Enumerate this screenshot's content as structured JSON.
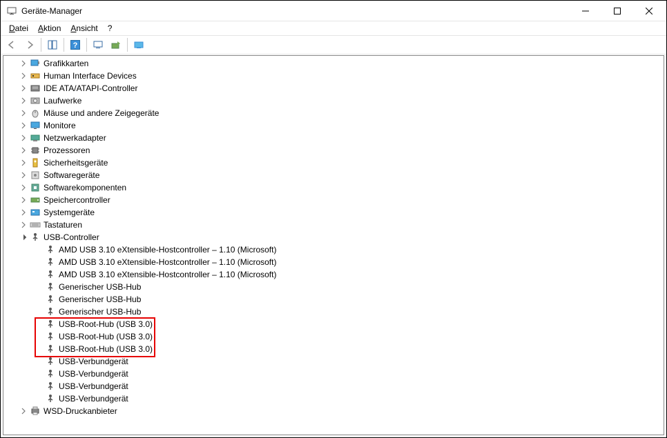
{
  "window": {
    "title": "Geräte-Manager"
  },
  "menu": {
    "file": "Datei",
    "action": "Aktion",
    "view": "Ansicht",
    "help": "?"
  },
  "categories": [
    {
      "label": "Grafikkarten",
      "icon": "display-adapter"
    },
    {
      "label": "Human Interface Devices",
      "icon": "hid"
    },
    {
      "label": "IDE ATA/ATAPI-Controller",
      "icon": "ide"
    },
    {
      "label": "Laufwerke",
      "icon": "disk"
    },
    {
      "label": "Mäuse und andere Zeigegeräte",
      "icon": "mouse"
    },
    {
      "label": "Monitore",
      "icon": "monitor"
    },
    {
      "label": "Netzwerkadapter",
      "icon": "network"
    },
    {
      "label": "Prozessoren",
      "icon": "cpu"
    },
    {
      "label": "Sicherheitsgeräte",
      "icon": "security"
    },
    {
      "label": "Softwaregeräte",
      "icon": "software"
    },
    {
      "label": "Softwarekomponenten",
      "icon": "component"
    },
    {
      "label": "Speichercontroller",
      "icon": "storage"
    },
    {
      "label": "Systemgeräte",
      "icon": "system"
    },
    {
      "label": "Tastaturen",
      "icon": "keyboard"
    }
  ],
  "usb_category": {
    "label": "USB-Controller",
    "expanded": true,
    "children": [
      {
        "label": "AMD USB 3.10 eXtensible-Hostcontroller – 1.10 (Microsoft)",
        "highlight": false
      },
      {
        "label": "AMD USB 3.10 eXtensible-Hostcontroller – 1.10 (Microsoft)",
        "highlight": false
      },
      {
        "label": "AMD USB 3.10 eXtensible-Hostcontroller – 1.10 (Microsoft)",
        "highlight": false
      },
      {
        "label": "Generischer USB-Hub",
        "highlight": false
      },
      {
        "label": "Generischer USB-Hub",
        "highlight": false
      },
      {
        "label": "Generischer USB-Hub",
        "highlight": false
      },
      {
        "label": "USB-Root-Hub (USB 3.0)",
        "highlight": true
      },
      {
        "label": "USB-Root-Hub (USB 3.0)",
        "highlight": true
      },
      {
        "label": "USB-Root-Hub (USB 3.0)",
        "highlight": true
      },
      {
        "label": "USB-Verbundgerät",
        "highlight": false
      },
      {
        "label": "USB-Verbundgerät",
        "highlight": false
      },
      {
        "label": "USB-Verbundgerät",
        "highlight": false
      },
      {
        "label": "USB-Verbundgerät",
        "highlight": false
      }
    ]
  },
  "last_category": {
    "label": "WSD-Druckanbieter",
    "icon": "printer"
  }
}
